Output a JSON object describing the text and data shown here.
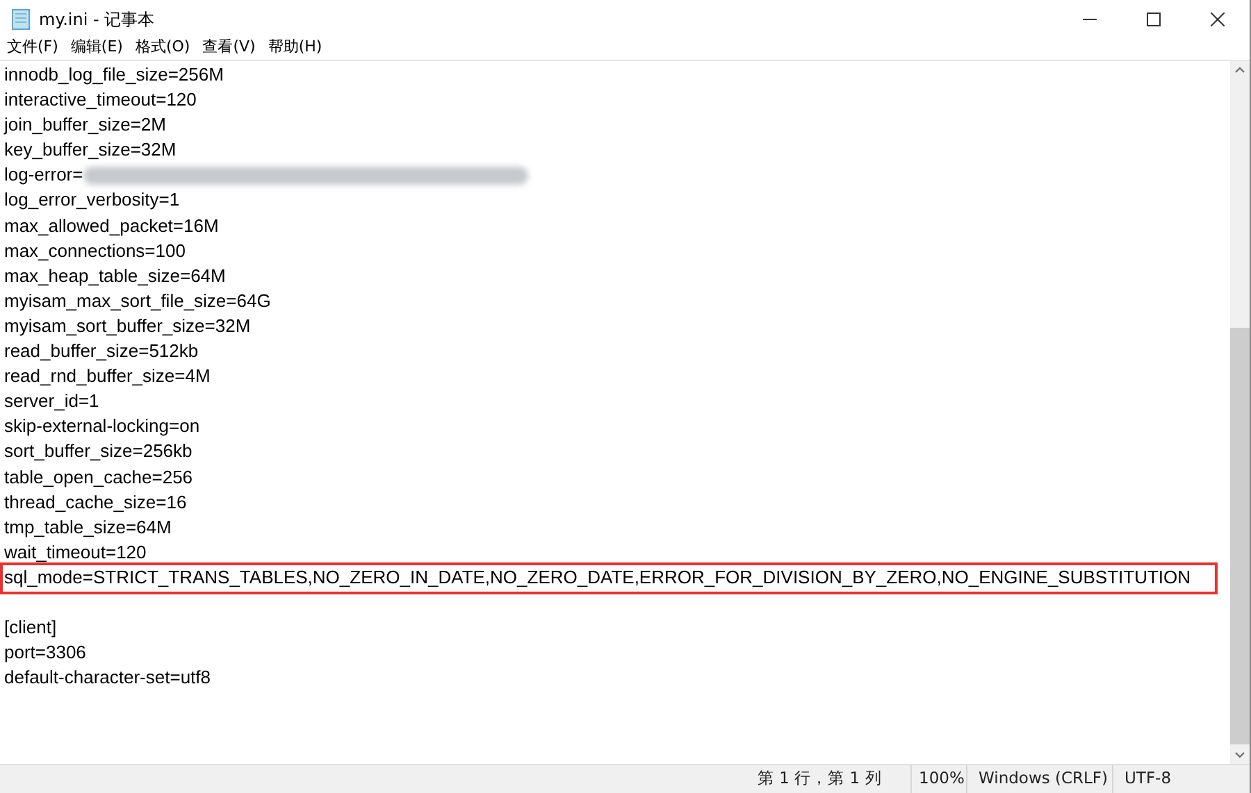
{
  "window": {
    "title": "my.ini - 记事本"
  },
  "menu": [
    "文件(F)",
    "编辑(E)",
    "格式(O)",
    "查看(V)",
    "帮助(H)"
  ],
  "lines": [
    {
      "text": "innodb_log_file_size=256M"
    },
    {
      "text": "interactive_timeout=120"
    },
    {
      "text": "join_buffer_size=2M"
    },
    {
      "text": "key_buffer_size=32M"
    },
    {
      "text": "log-error=",
      "redacted": true
    },
    {
      "text": "log_error_verbosity=1"
    },
    {
      "text": "max_allowed_packet=16M"
    },
    {
      "text": "max_connections=100"
    },
    {
      "text": "max_heap_table_size=64M"
    },
    {
      "text": "myisam_max_sort_file_size=64G"
    },
    {
      "text": "myisam_sort_buffer_size=32M"
    },
    {
      "text": "read_buffer_size=512kb"
    },
    {
      "text": "read_rnd_buffer_size=4M"
    },
    {
      "text": "server_id=1"
    },
    {
      "text": "skip-external-locking=on"
    },
    {
      "text": "sort_buffer_size=256kb"
    },
    {
      "text": "table_open_cache=256"
    },
    {
      "text": "thread_cache_size=16"
    },
    {
      "text": "tmp_table_size=64M"
    },
    {
      "text": "wait_timeout=120"
    },
    {
      "text": "sql_mode=STRICT_TRANS_TABLES,NO_ZERO_IN_DATE,NO_ZERO_DATE,ERROR_FOR_DIVISION_BY_ZERO,NO_ENGINE_SUBSTITUTION",
      "highlighted": true
    },
    {
      "text": "[client]",
      "blank_line_before": true
    },
    {
      "text": "port=3306"
    },
    {
      "text": "default-character-set=utf8"
    }
  ],
  "status_bar": [
    "第 1 行，第 1 列",
    "100%",
    "Windows (CRLF)",
    "UTF-8"
  ]
}
